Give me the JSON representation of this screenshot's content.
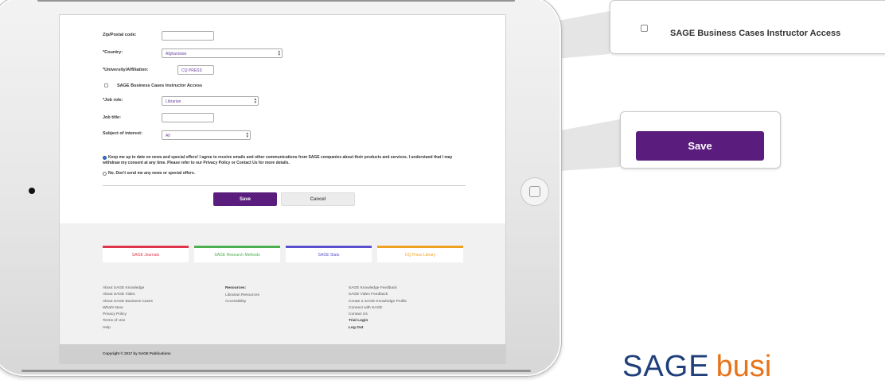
{
  "form": {
    "zip_label": "Zip/Postal code:",
    "zip_value": "",
    "country_label": "*Country:",
    "country_value": "Afghanistan",
    "university_label": "*University/Affiliation:",
    "university_value": "CQ PRESS",
    "instructor_access_label": "SAGE Business Cases Instructor Access",
    "job_role_label": "*Job role:",
    "job_role_value": "Librarian",
    "job_title_label": "Job title:",
    "job_title_value": "",
    "subject_label": "Subject of interest:",
    "subject_value": "All",
    "consent_yes_text": "Keep me up to date on news and special offers! I agree to receive emails and other communications from SAGE companies about their products and services. I understand that I may withdraw my consent at any time. Please refer to our Privacy Policy or Contact Us for more details.",
    "consent_no_text": "No. Don't send me any news or special offers.",
    "save_label": "Save",
    "cancel_label": "Cancel"
  },
  "product_tiles": [
    {
      "label": "SAGE Journals",
      "color": "#e0344c"
    },
    {
      "label": "SAGE Research Methods",
      "color": "#4caf50"
    },
    {
      "label": "SAGE Stats",
      "color": "#5a4fcf"
    },
    {
      "label": "CQ Press Library",
      "color": "#f0a020"
    }
  ],
  "footer": {
    "col1": [
      "About SAGE Knowledge",
      "About SAGE Video",
      "About SAGE Business Cases",
      "What's New",
      "Privacy Policy",
      "Terms of Use",
      "Help"
    ],
    "col2_heading": "Resources:",
    "col2": [
      "Librarian Resources",
      "Accessibility"
    ],
    "col3": [
      "SAGE Knowledge Feedback",
      "SAGE Video Feedback",
      "Create a SAGE Knowledge Profile",
      "Connect with SAGE",
      "Contact Us"
    ],
    "col3_bold": [
      "Trial Login",
      "Log Out"
    ],
    "copyright": "Copyright © 2017 by SAGE Publications"
  },
  "callouts": {
    "instructor_access_label": "SAGE Business Cases Instructor Access",
    "save_label": "Save"
  },
  "brand": {
    "sage": "SAGE",
    "business": "busi"
  },
  "colors": {
    "primary_purple": "#5a1d7d",
    "brand_blue": "#1f3f7a",
    "brand_orange": "#e8731a"
  }
}
